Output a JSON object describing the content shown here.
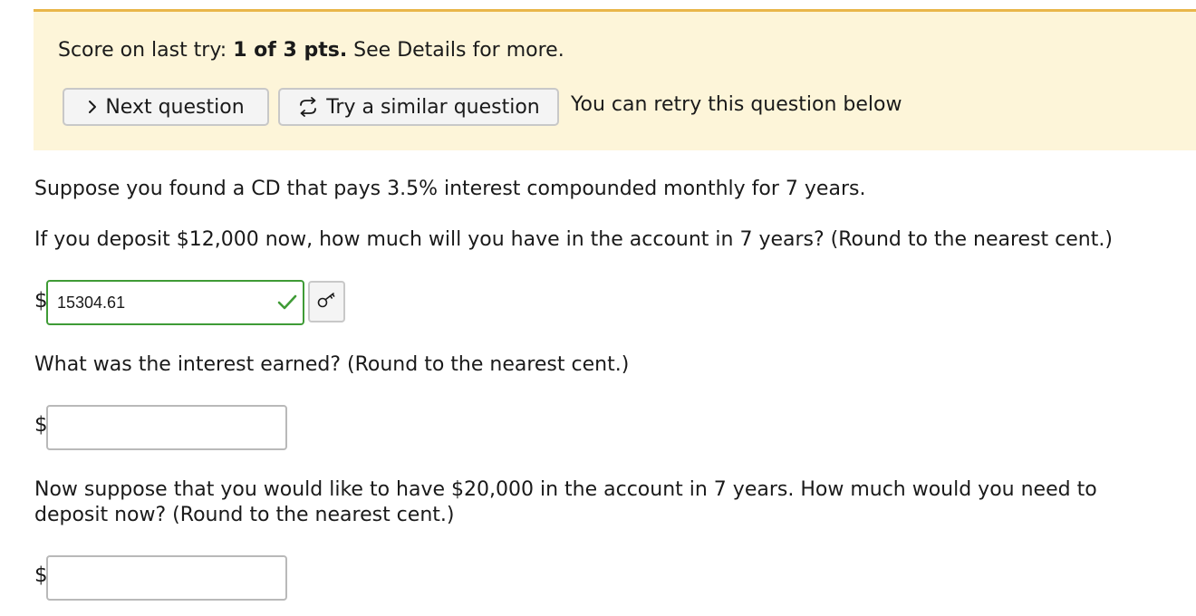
{
  "banner": {
    "score_prefix": "Score on last try: ",
    "score_value": "1 of 3 pts.",
    "score_suffix": " See Details for more.",
    "next_label": "Next question",
    "similar_label": "Try a similar question",
    "retry_note": "You can retry this question below",
    "background_color": "#fdf5d9",
    "accent_color": "#e9b64a"
  },
  "question": {
    "intro": "Suppose you found a CD that pays 3.5% interest compounded monthly for 7 years.",
    "parts": [
      {
        "prompt": "If you deposit $12,000 now, how much will you have in the account in 7 years? (Round to the nearest cent.)",
        "currency": "$",
        "value": "15304.61",
        "status": "correct",
        "status_icon": "check-icon",
        "status_color": "#3f9b36"
      },
      {
        "prompt": "What was the interest earned? (Round to the nearest cent.)",
        "currency": "$",
        "value": ""
      },
      {
        "prompt": "Now suppose that you would like to have $20,000 in the account in 7 years. How much would you need to deposit now? (Round to the nearest cent.)",
        "currency": "$",
        "value": ""
      }
    ]
  },
  "icons": {
    "next": "chevron-right-icon",
    "similar": "retry-arrows-icon",
    "key": "key-icon"
  }
}
